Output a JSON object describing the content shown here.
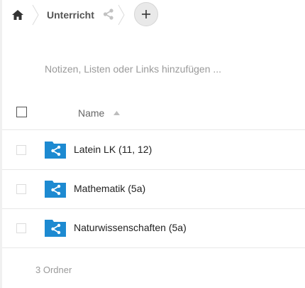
{
  "breadcrumb": {
    "home_icon": "home-icon",
    "current": "Unterricht",
    "share_icon": "share-icon",
    "add_icon": "plus-icon"
  },
  "notes": {
    "placeholder": "Notizen, Listen oder Links hinzufügen ..."
  },
  "table": {
    "header": {
      "name_label": "Name",
      "sort": "ascending"
    },
    "rows": [
      {
        "name": "Latein LK (11, 12)",
        "icon": "shared-folder-icon"
      },
      {
        "name": "Mathematik (5a)",
        "icon": "shared-folder-icon"
      },
      {
        "name": "Naturwissenschaften (5a)",
        "icon": "shared-folder-icon"
      }
    ],
    "summary": "3 Ordner"
  },
  "colors": {
    "folder": "#1d8ad1",
    "text_muted": "#9a9a9a",
    "add_button_bg": "#e9e9e9"
  }
}
